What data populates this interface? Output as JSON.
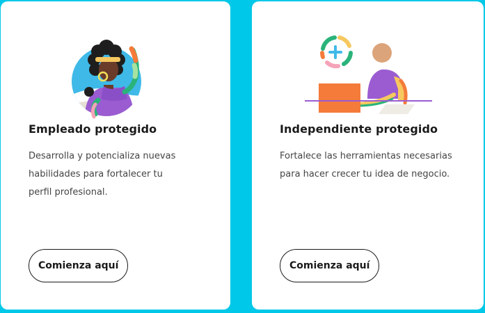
{
  "cards": [
    {
      "title": "Empleado protegido",
      "description": "Desarrolla y potencializa nuevas habilidades para fortalecer tu perfil profesional.",
      "button_label": "Comienza aquí",
      "illustration": "employee-illustration"
    },
    {
      "title": "Independiente protegido",
      "description": "Fortalece las herramientas necesarias para hacer crecer tu idea de negocio.",
      "button_label": "Comienza aquí",
      "illustration": "freelancer-illustration"
    }
  ],
  "colors": {
    "background": "#00c8e8",
    "card": "#ffffff",
    "text": "#1a1a1a",
    "muted_text": "#444444"
  }
}
